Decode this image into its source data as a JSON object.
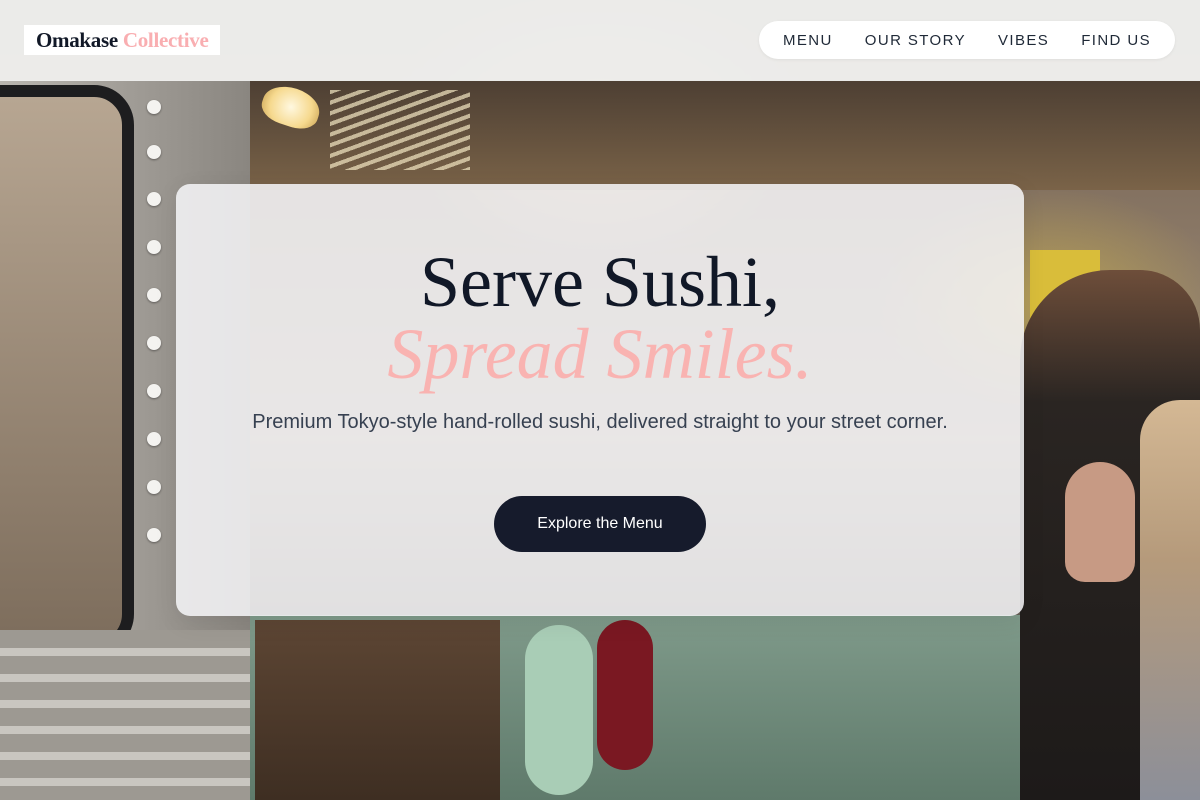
{
  "brand": {
    "name_main": "Omakase",
    "name_accent": "Collective",
    "colors": {
      "dark": "#111827",
      "accent_pink": "#f9aeb1",
      "button_bg": "#161b2c"
    }
  },
  "nav": {
    "items": [
      {
        "label": "MENU"
      },
      {
        "label": "OUR STORY"
      },
      {
        "label": "VIBES"
      },
      {
        "label": "FIND US"
      }
    ]
  },
  "hero": {
    "title": "Serve Sushi,",
    "subtitle": "Spread Smiles.",
    "description": "Premium Tokyo-style hand-rolled sushi, delivered straight to your street corner.",
    "cta_label": "Explore the Menu"
  }
}
